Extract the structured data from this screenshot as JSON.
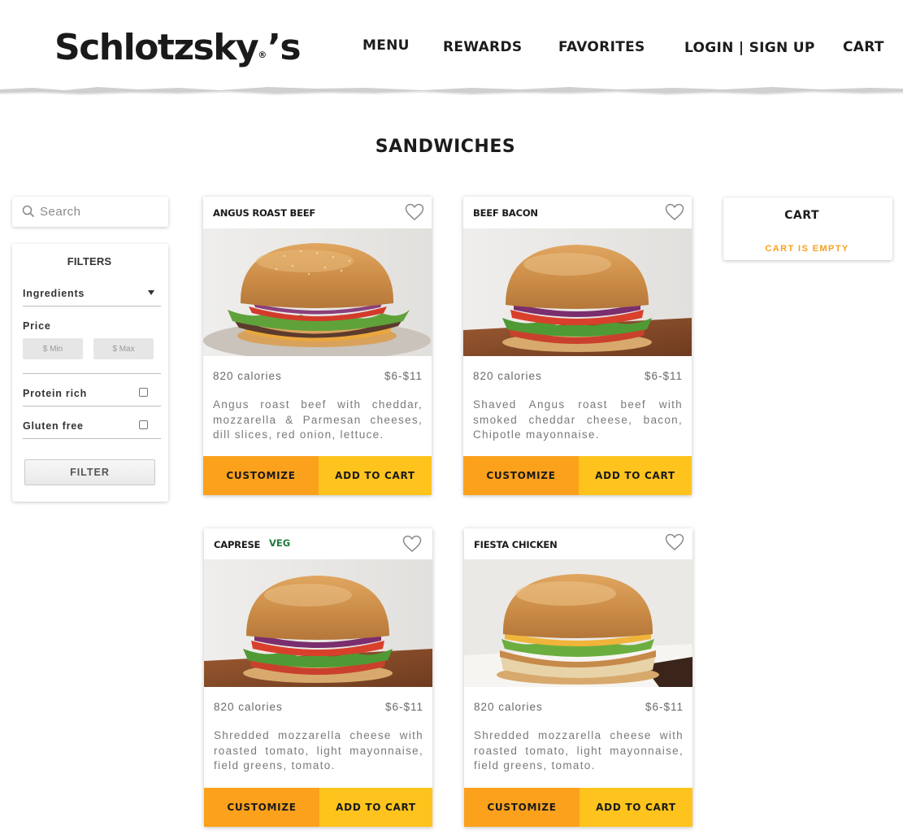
{
  "brand": {
    "name": "Schlotzsky",
    "suffix": "’s",
    "registered": "®"
  },
  "nav": {
    "menu": "MENU",
    "rewards": "REWARDS",
    "favorites": "FAVORITES",
    "login": "LOGIN | SIGN UP",
    "cart": "CART"
  },
  "page": {
    "title": "SANDWICHES"
  },
  "search": {
    "placeholder": "Search"
  },
  "filters": {
    "title": "FILTERS",
    "ingredients_label": "Ingredients",
    "price_label": "Price",
    "price_min_placeholder": "$ Min",
    "price_max_placeholder": "$ Max",
    "protein_label": "Protein rich",
    "protein_checked": false,
    "gluten_label": "Gluten free",
    "gluten_checked": false,
    "button_label": "FILTER"
  },
  "products": [
    {
      "name": "ANGUS ROAST BEEF",
      "badge": "",
      "calories": "820 calories",
      "price": "$6-$11",
      "description": "Angus roast beef with cheddar, mozzarella & Parmesan cheeses, dill slices, red onion, lettuce.",
      "customize_label": "CUSTOMIZE",
      "add_label": "ADD TO CART",
      "favorited": false,
      "image_icon": "sandwich-photo"
    },
    {
      "name": "BEEF BACON",
      "badge": "",
      "calories": "820 calories",
      "price": "$6-$11",
      "description": "Shaved Angus roast beef with smoked cheddar cheese, bacon, Chipotle mayonnaise.",
      "customize_label": "CUSTOMIZE",
      "add_label": "ADD TO CART",
      "favorited": false,
      "image_icon": "sandwich-photo"
    },
    {
      "name": "CAPRESE",
      "badge": "VEG",
      "calories": "820 calories",
      "price": "$6-$11",
      "description": "Shredded mozzarella cheese with roasted tomato, light mayonnaise, field greens, tomato.",
      "customize_label": "CUSTOMIZE",
      "add_label": "ADD TO CART",
      "favorited": false,
      "image_icon": "sandwich-photo"
    },
    {
      "name": "FIESTA CHICKEN",
      "badge": "",
      "calories": "820 calories",
      "price": "$6-$11",
      "description": "Shredded mozzarella cheese with roasted tomato, light mayonnaise, field greens, tomato.",
      "customize_label": "CUSTOMIZE",
      "add_label": "ADD TO CART",
      "favorited": false,
      "image_icon": "sandwich-photo"
    }
  ],
  "cart": {
    "title": "CART",
    "empty_text": "CART IS EMPTY"
  },
  "colors": {
    "customize": "#fca11c",
    "add_to_cart": "#fec41d",
    "veg": "#1d7a3c",
    "cart_empty": "#f7a11f"
  }
}
